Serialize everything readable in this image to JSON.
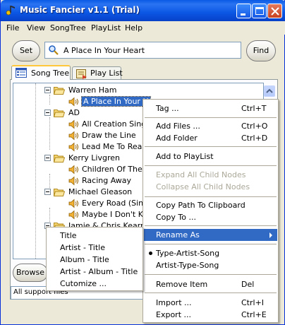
{
  "window": {
    "title": "Music Fancier v1.1 (Trial)"
  },
  "menubar": {
    "items": [
      "File",
      "View",
      "SongTree",
      "PlayList",
      "Help"
    ]
  },
  "toolbar": {
    "set_label": "Set",
    "find_label": "Find",
    "search_value": "A Place In Your Heart",
    "search_icon": "magnifier-icon"
  },
  "tabs": [
    {
      "label": "Song Tree",
      "icon": "tree-grid-icon",
      "active": true
    },
    {
      "label": "Play List",
      "icon": "playlist-icon",
      "active": false
    }
  ],
  "tree": {
    "items": [
      {
        "label": "Warren Ham",
        "type": "folder"
      },
      {
        "label": "A Place In Your H",
        "type": "song",
        "selected": true
      },
      {
        "label": "AD",
        "type": "folder"
      },
      {
        "label": "All Creation Sings",
        "type": "song"
      },
      {
        "label": "Draw the Line",
        "type": "song"
      },
      {
        "label": "Lead Me To Reas",
        "type": "song"
      },
      {
        "label": "Kerry Livgren",
        "type": "folder"
      },
      {
        "label": "Children Of The S",
        "type": "song"
      },
      {
        "label": "Racing Away",
        "type": "song"
      },
      {
        "label": "Michael Gleason",
        "type": "folder"
      },
      {
        "label": "Every Road (Singl",
        "type": "song"
      },
      {
        "label": "Maybe I Don't Kno",
        "type": "song"
      },
      {
        "label": "Jamie & Chris Kearney",
        "type": "folder"
      }
    ]
  },
  "bottom": {
    "browse_label": "Browse",
    "filter_value": "All support files"
  },
  "context_menu": {
    "items": [
      {
        "label": "Tag ...",
        "shortcut": "Ctrl+T"
      },
      {
        "label": "Add Files ...",
        "shortcut": "Ctrl+O"
      },
      {
        "label": "Add Folder",
        "shortcut": "Ctrl+D"
      },
      {
        "label": "Add to PlayList",
        "shortcut": ""
      },
      {
        "label": "Expand All Child Nodes",
        "shortcut": "",
        "disabled": true
      },
      {
        "label": "Collapse All Child Nodes",
        "shortcut": "",
        "disabled": true
      },
      {
        "label": "Copy Path To Clipboard",
        "shortcut": ""
      },
      {
        "label": "Copy To ...",
        "shortcut": ""
      },
      {
        "label": "Rename As",
        "shortcut": "",
        "submenu": true,
        "highlighted": true
      },
      {
        "label": "Type-Artist-Song",
        "shortcut": "",
        "checked": true
      },
      {
        "label": "Artist-Type-Song",
        "shortcut": ""
      },
      {
        "label": "Remove Item",
        "shortcut": "Del"
      },
      {
        "label": "Import ...",
        "shortcut": "Ctrl+I"
      },
      {
        "label": "Export ...",
        "shortcut": "Ctrl+E"
      }
    ]
  },
  "rename_submenu": {
    "items": [
      "Title",
      "Artist - Title",
      "Album - Title",
      "Artist - Album - Title",
      "Cutomize ..."
    ]
  },
  "colors": {
    "titlebar": "#0b57e3",
    "selection": "#316ac5",
    "window_bg": "#ece9d8",
    "disabled_text": "#aca899"
  }
}
